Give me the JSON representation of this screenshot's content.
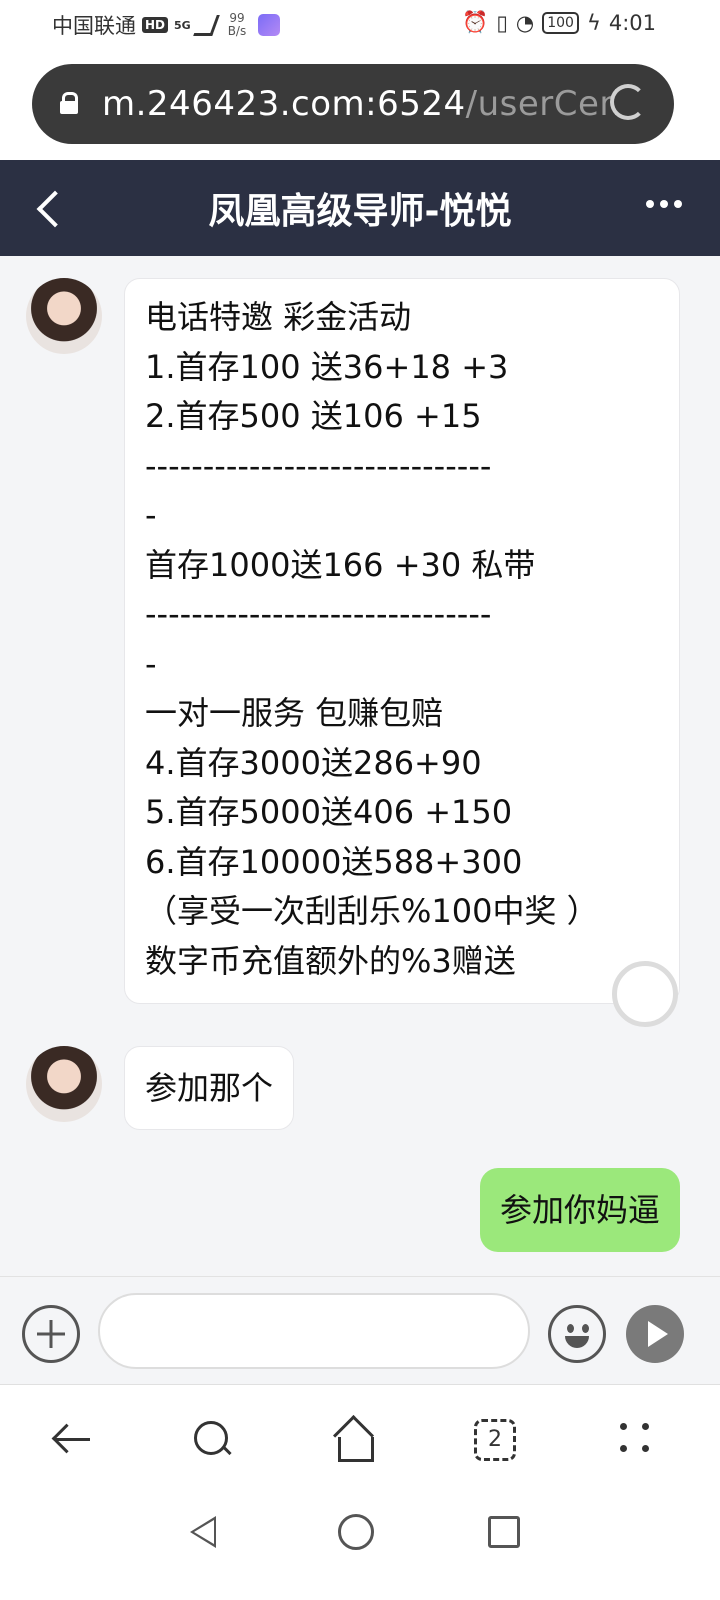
{
  "status_bar": {
    "carrier": "中国联通",
    "hd_badge": "HD",
    "network": "5G",
    "speed_value": "99",
    "speed_unit": "B/s",
    "battery": "100",
    "time": "4:01"
  },
  "browser": {
    "url_host": "m.246423.com:6524",
    "url_path": "/userCen"
  },
  "header": {
    "title": "凤凰高级导师-悦悦"
  },
  "messages": {
    "first": {
      "lines": [
        "电话特邀 彩金活动",
        "1.首存100 送36+18 +3",
        "2.首存500 送106 +15",
        "------------------------------",
        "-",
        "首存1000送166 +30 私带",
        "------------------------------",
        "-",
        "一对一服务 包赚包赔",
        "4.首存3000送286+90",
        "5.首存5000送406 +150",
        "6.首存10000送588+300",
        "（享受一次刮刮乐%100中奖 ）",
        "数字币充值额外的%3赠送"
      ]
    },
    "second": {
      "text": "参加那个"
    },
    "reply": {
      "text": "参加你妈逼"
    }
  },
  "tabs_count": "2",
  "colors": {
    "nav_bg": "#2b3043",
    "my_bubble": "#9be87b",
    "page_bg": "#f4f5f7"
  },
  "icons": [
    "lock-icon",
    "reload-icon",
    "back-chevron-icon",
    "more-icon",
    "collapse-icon",
    "plus-icon",
    "emoji-icon",
    "send-icon",
    "arrow-back-icon",
    "search-icon",
    "home-icon",
    "tabs-icon",
    "menu-dots-icon"
  ]
}
